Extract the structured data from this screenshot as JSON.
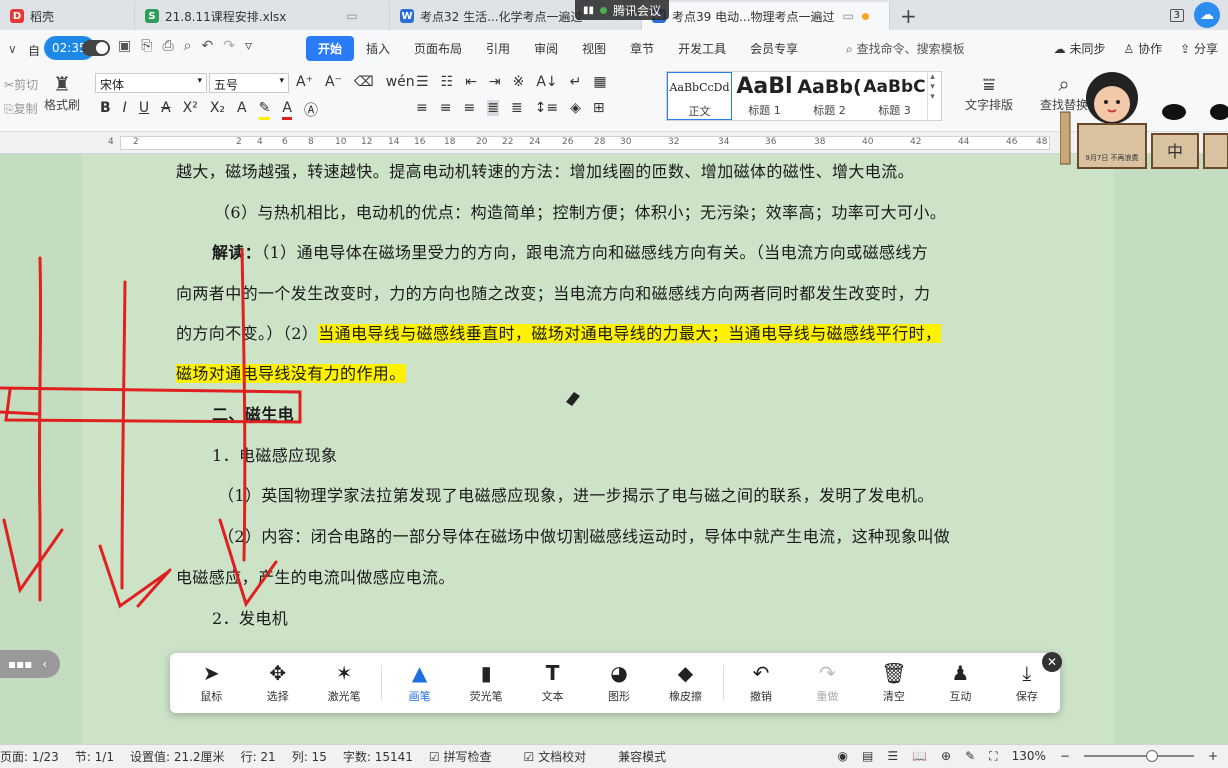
{
  "tabs": [
    {
      "label": "稻壳",
      "icon_color": "#e53935",
      "icon": "D"
    },
    {
      "label": "21.8.11课程安排.xlsx",
      "icon_color": "#2e9e5b",
      "icon": "S"
    },
    {
      "label": "考点32 生活...化学考点一遍过",
      "icon_color": "#2a6fd6",
      "icon": "W"
    },
    {
      "label": "考点39 电动...物理考点一遍过",
      "icon_color": "#2a6fd6",
      "icon": "W"
    }
  ],
  "meeting_label": "腾讯会议",
  "tab_count": "3",
  "timer": "02:35",
  "auto_label": "自",
  "menu": [
    "开始",
    "插入",
    "页面布局",
    "引用",
    "审阅",
    "视图",
    "章节",
    "开发工具",
    "会员专享"
  ],
  "search_placeholder": "查找命令、搜索模板",
  "menu_right": [
    "未同步",
    "协作",
    "分享"
  ],
  "ribbon": {
    "cut": "剪切",
    "copy": "复制",
    "format_painter": "格式刷",
    "font": "宋体",
    "size": "五号",
    "styles": [
      {
        "preview": "AaBbCcDd",
        "caption": "正文"
      },
      {
        "preview": "AaBl",
        "caption": "标题 1"
      },
      {
        "preview": "AaBb(",
        "caption": "标题 2"
      },
      {
        "preview": "AaBbC",
        "caption": "标题 3"
      }
    ],
    "text_layout": "文字排版",
    "find_replace": "查找替换"
  },
  "ruler_ticks": [
    "4",
    "2",
    "2",
    "4",
    "6",
    "8",
    "10",
    "12",
    "14",
    "16",
    "18",
    "20",
    "22",
    "24",
    "26",
    "28",
    "30",
    "32",
    "34",
    "36",
    "38",
    "40",
    "42",
    "44",
    "46",
    "48"
  ],
  "document_lines": [
    "越大，磁场越强，转速越快。提高电动机转速的方法：增加线圈的匝数、增加磁体的磁性、增大电流。",
    "（6）与热机相比，电动机的优点：构造简单；控制方便；体积小；无污染；效率高；功率可大可小。",
    "解读：（1）通电导体在磁场里受力的方向，跟电流方向和磁感线方向有关。（当电流方向或磁感线方",
    "向两者中的一个发生改变时，力的方向也随之改变；当电流方向和磁感线方向两者同时都发生改变时，力",
    "的方向不变。）（2）",
    "当通电导线与磁感线垂直时，磁场对通电导线的力最大；当通电导线与磁感线平行时，",
    "磁场对通电导线没有力的作用。",
    "二、磁生电",
    "1．电磁感应现象",
    "（1）英国物理学家法拉第发现了电磁感应现象，进一步揭示了电与磁之间的联系，发明了发电机。",
    "（2）内容：闭合电路的一部分导体在磁场中做切割磁感线运动时，导体中就产生电流，这种现象叫做",
    "电磁感应，产生的电流叫做感应电流。",
    "2．发电机"
  ],
  "pen_toolbar": [
    "鼠标",
    "选择",
    "激光笔",
    "画笔",
    "荧光笔",
    "文本",
    "图形",
    "橡皮擦",
    "撤销",
    "重做",
    "清空",
    "互动",
    "保存"
  ],
  "status": {
    "page": "页面: 1/23",
    "section": "节: 1/1",
    "setting": "设置值: 21.2厘米",
    "row": "行: 21",
    "col": "列: 15",
    "words": "字数: 15141",
    "spell": "拼写检查",
    "proof": "文档校对",
    "compat": "兼容模式",
    "zoom": "130%"
  },
  "mascot_text": "9月7日 不再浪费",
  "mascot_label": "中",
  "ink_color": "#e02020",
  "highlight_color": "#fff200",
  "accent": "#2a7bf6"
}
